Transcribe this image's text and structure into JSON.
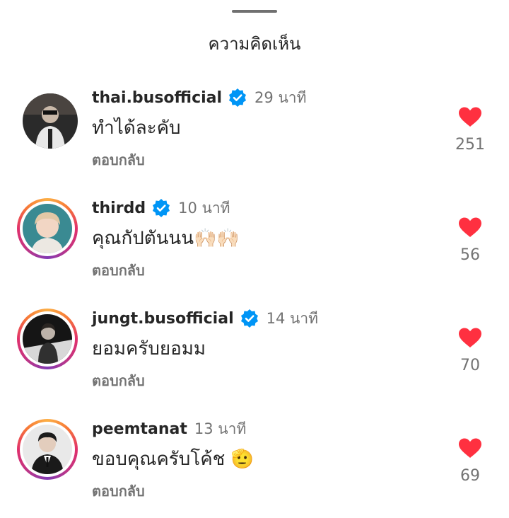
{
  "header": {
    "title": "ความคิดเห็น"
  },
  "comments": [
    {
      "username": "thai.busofficial",
      "verified": true,
      "time": "29 นาที",
      "text": "ทำได้ละคับ",
      "reply_label": "ตอบกลับ",
      "likes": "251"
    },
    {
      "username": "thirdd",
      "verified": true,
      "time": "10 นาที",
      "text": "คุณกัปตันนน🙌🏻🙌🏻",
      "reply_label": "ตอบกลับ",
      "likes": "56"
    },
    {
      "username": "jungt.busofficial",
      "verified": true,
      "time": "14 นาที",
      "text": "ยอมครับยอมม",
      "reply_label": "ตอบกลับ",
      "likes": "70"
    },
    {
      "username": "peemtanat",
      "verified": false,
      "time": "13 นาที",
      "text": "ขอบคุณครับโค้ช 🫡",
      "reply_label": "ตอบกลับ",
      "likes": "69"
    }
  ],
  "icons": {
    "verified": "verified-badge-icon",
    "like": "heart-icon"
  },
  "colors": {
    "heart": "#ff3040",
    "verified": "#0095f6",
    "secondary_text": "#737373"
  }
}
